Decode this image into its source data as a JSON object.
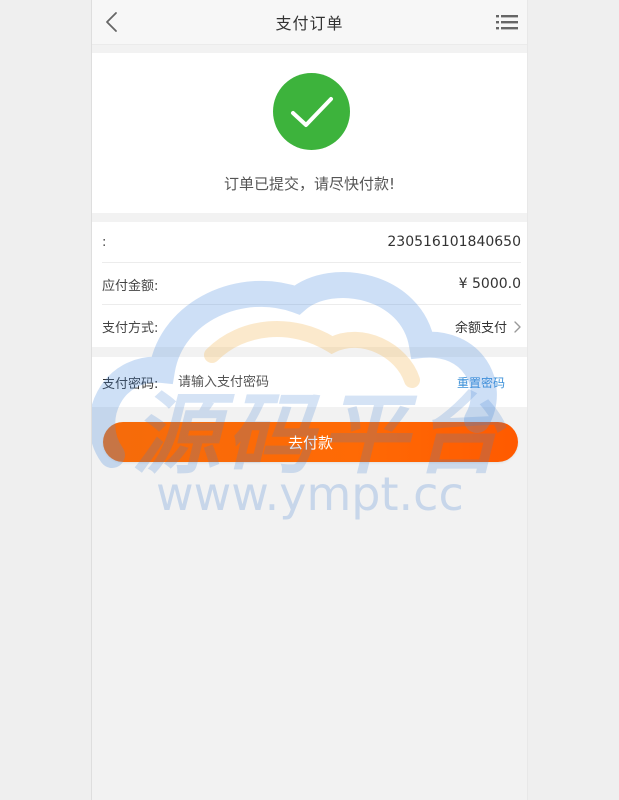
{
  "header": {
    "title": "支付订单",
    "back_icon": "chevron-left-icon",
    "menu_icon": "list-menu-icon"
  },
  "success": {
    "icon": "check-icon",
    "message": "订单已提交，请尽快付款!",
    "icon_color": "#3db33c"
  },
  "order": {
    "rows": [
      {
        "label": ":",
        "value": "230516101840650"
      },
      {
        "label": "应付金额:",
        "value": "¥ 5000.0"
      },
      {
        "label": "支付方式:",
        "value": "余额支付"
      }
    ]
  },
  "password": {
    "label": "支付密码:",
    "placeholder": "请输入支付密码",
    "reset_label": "重置密码"
  },
  "pay_button": {
    "label": "去付款",
    "color": "#ff6a05"
  },
  "watermark": {
    "title": "源码平台",
    "url": "www.ympt.cc"
  }
}
